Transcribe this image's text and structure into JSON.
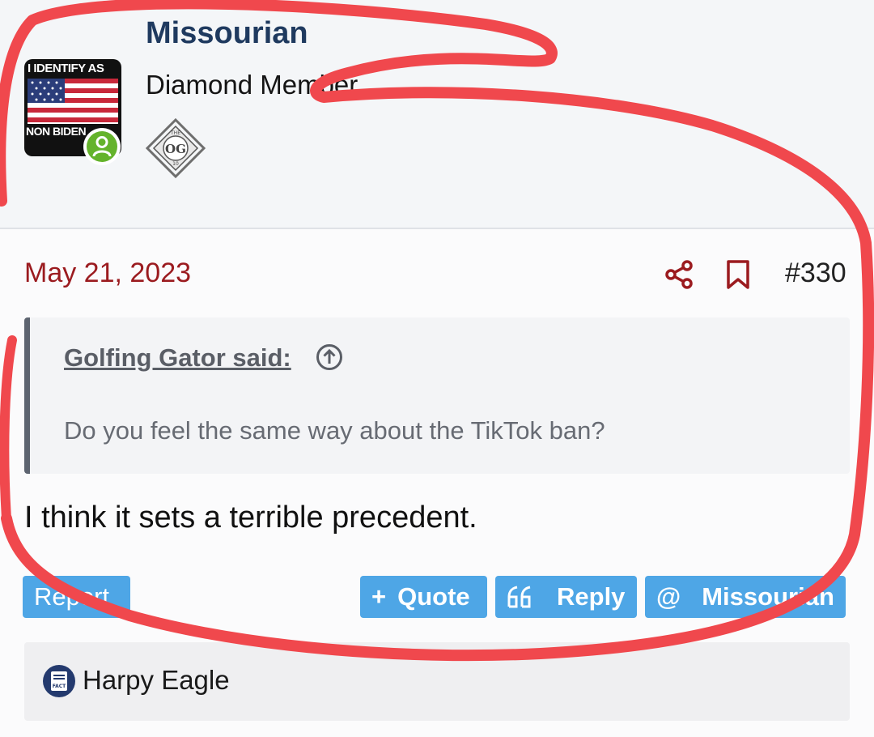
{
  "user": {
    "name": "Missourian",
    "title": "Diamond Member",
    "avatar_text_top": "I IDENTIFY AS",
    "avatar_text_bottom": "NON BIDEN",
    "trophy_text": "OG",
    "trophy_small_top": "THE",
    "trophy_small_bottom": "10"
  },
  "post": {
    "date": "May 21, 2023",
    "number": "#330",
    "quote": {
      "author": "Golfing Gator said:",
      "text": "Do you feel the same way about the TikTok ban?"
    },
    "body": "I think it sets a terrible precedent."
  },
  "actions": {
    "report": "Report",
    "quote": "Quote",
    "quote_prefix": "+",
    "reply": "Reply",
    "mention_prefix": "@",
    "mention": "Missourian"
  },
  "reactions": {
    "user": "Harpy Eagle",
    "icon_text": "FACT"
  },
  "colors": {
    "accent_red": "#9b1b1f",
    "button_blue": "#4ea6e6",
    "online_green": "#64b32b",
    "annotation_red": "#f0484d"
  },
  "icons": [
    "online-status-icon",
    "trophy-og-icon",
    "share-icon",
    "bookmark-icon",
    "arrow-up-circle-icon",
    "quote-marks-icon",
    "fact-reaction-icon"
  ]
}
